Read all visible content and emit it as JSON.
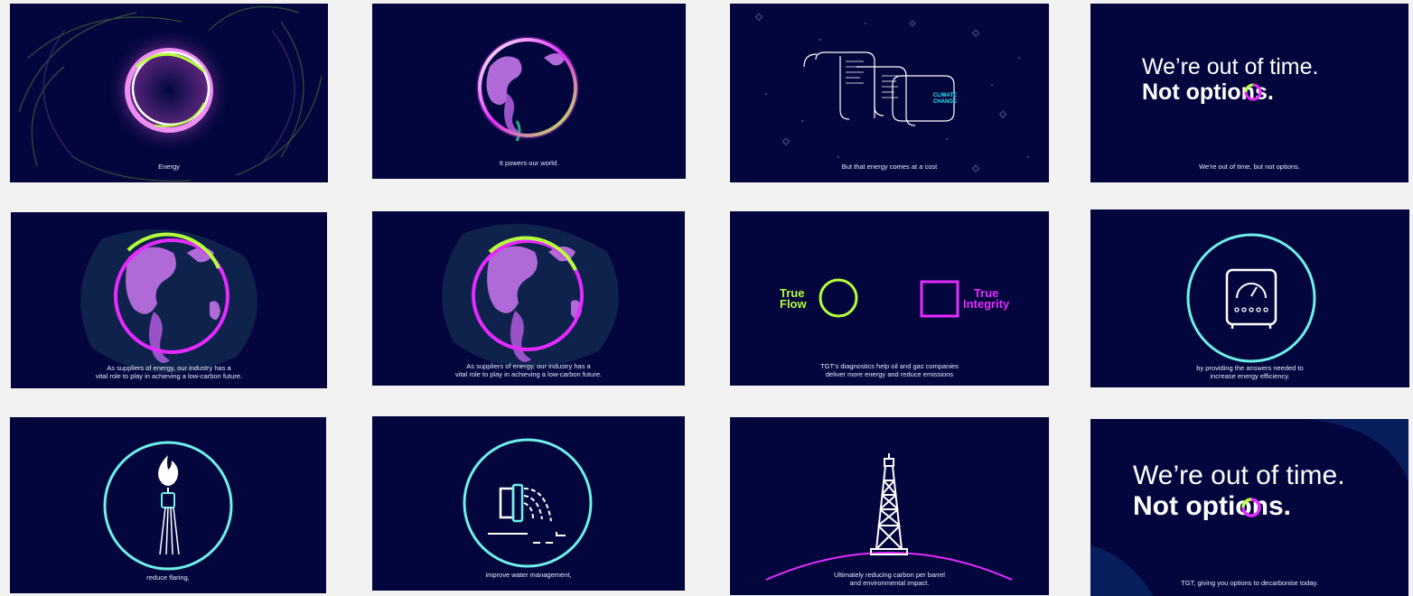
{
  "frames": [
    {
      "caption": "Energy",
      "icon": "energy-ring"
    },
    {
      "caption": "It powers our world.",
      "icon": "globe"
    },
    {
      "caption": "But that energy comes at a cost",
      "icon": "document-scroll",
      "scroll_label": "CLIMATE\nCHANGE"
    },
    {
      "caption": "We're out of time, but not options.",
      "headline_line1": "We’re out of time.",
      "headline_line2": "Not options."
    },
    {
      "caption": "As suppliers of energy, our industry has a\nvital role to play in achieving a low-carbon future.",
      "icon": "globe-dots"
    },
    {
      "caption": "As suppliers of energy, our industry has a\nvital role to play in achieving a low-carbon future.",
      "icon": "globe-dots"
    },
    {
      "caption": "TGT’s diagnostics help oil and gas companies\ndeliver more energy and reduce emissions",
      "icon": "true-flow-integrity",
      "label_flow": "True\nFlow",
      "label_integrity": "True\nIntegrity"
    },
    {
      "caption": "by providing the answers needed to\nincrease energy efficiency.",
      "icon": "gauge-device"
    },
    {
      "caption": "reduce flaring,",
      "icon": "flare-torch"
    },
    {
      "caption": "improve water management,",
      "icon": "water-pipe"
    },
    {
      "caption": "Ultimately reducing carbon per barrel\nand environmental impact.",
      "icon": "oil-derrick"
    },
    {
      "caption": "TGT, giving you options to decarbonise today.",
      "headline_line1": "We’re out of time.",
      "headline_line2": "Not options."
    }
  ],
  "colors": {
    "background": "#02063d",
    "page": "#f2f2f2",
    "green": "#b6ff3b",
    "magenta": "#e62bff",
    "cyan": "#6ff0e8",
    "white": "#ffffff"
  }
}
